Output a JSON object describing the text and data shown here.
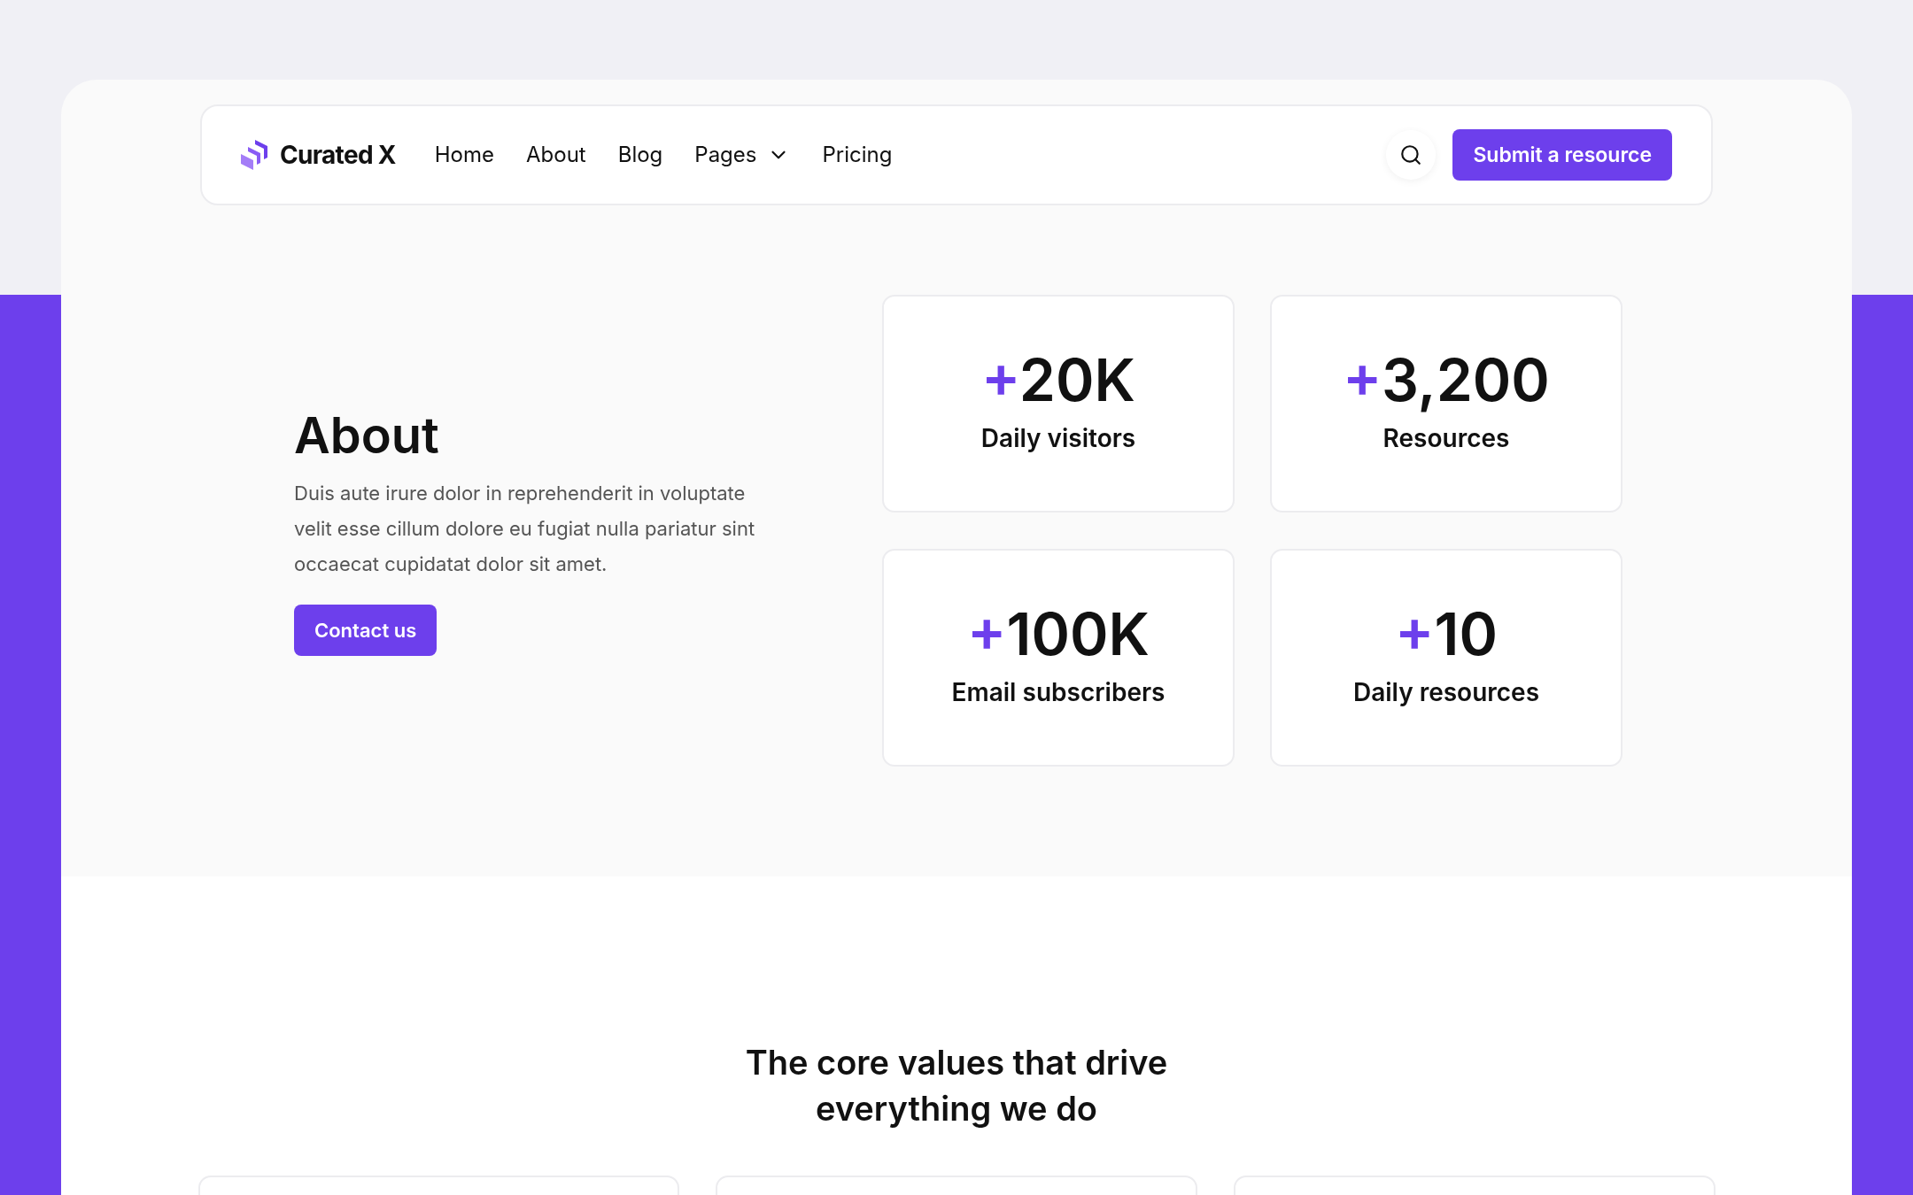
{
  "nav": {
    "brand": "Curated X",
    "links": [
      {
        "label": "Home",
        "dropdown": false
      },
      {
        "label": "About",
        "dropdown": false
      },
      {
        "label": "Blog",
        "dropdown": false
      },
      {
        "label": "Pages",
        "dropdown": true
      },
      {
        "label": "Pricing",
        "dropdown": false
      }
    ],
    "cta": "Submit a resource"
  },
  "hero": {
    "title": "About",
    "body": "Duis aute irure dolor in reprehenderit in voluptate velit esse cillum dolore eu fugiat nulla pariatur sint occaecat cupidatat dolor sit amet.",
    "button": "Contact us"
  },
  "stats": [
    {
      "prefix": "+",
      "value": "20K",
      "label": "Daily visitors"
    },
    {
      "prefix": "+",
      "value": "3,200",
      "label": "Resources"
    },
    {
      "prefix": "+",
      "value": "100K",
      "label": "Email subscribers"
    },
    {
      "prefix": "+",
      "value": "10",
      "label": "Daily resources"
    }
  ],
  "values": {
    "heading": "The core values that drive everything we do"
  }
}
